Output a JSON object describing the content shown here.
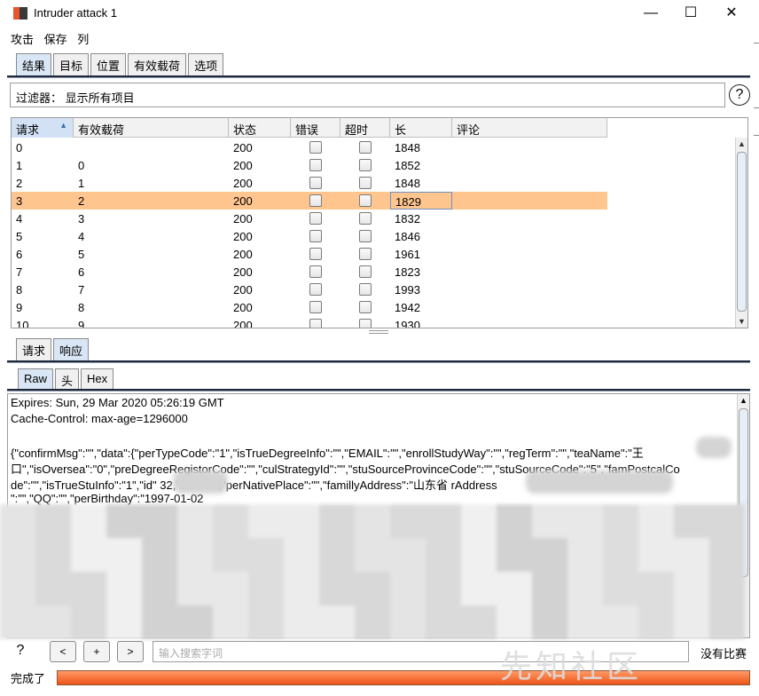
{
  "window": {
    "title": "Intruder attack 1",
    "minimize": "—",
    "maximize": "☐",
    "close": "✕"
  },
  "menu": [
    "攻击",
    "保存",
    "列"
  ],
  "main_tabs": [
    "结果",
    "目标",
    "位置",
    "有效载荷",
    "选项"
  ],
  "filter": {
    "text": "过滤器： 显示所有项目",
    "help": "?"
  },
  "table": {
    "columns": [
      "请求",
      "有效载荷",
      "状态",
      "错误",
      "超时",
      "长",
      "评论"
    ],
    "sort_indicator": "▲",
    "rows": [
      {
        "request": "0",
        "payload": "",
        "status": "200",
        "length": "1848"
      },
      {
        "request": "1",
        "payload": "0",
        "status": "200",
        "length": "1852"
      },
      {
        "request": "2",
        "payload": "1",
        "status": "200",
        "length": "1848"
      },
      {
        "request": "3",
        "payload": "2",
        "status": "200",
        "length": "1829"
      },
      {
        "request": "4",
        "payload": "3",
        "status": "200",
        "length": "1832"
      },
      {
        "request": "5",
        "payload": "4",
        "status": "200",
        "length": "1846"
      },
      {
        "request": "6",
        "payload": "5",
        "status": "200",
        "length": "1961"
      },
      {
        "request": "7",
        "payload": "6",
        "status": "200",
        "length": "1823"
      },
      {
        "request": "8",
        "payload": "7",
        "status": "200",
        "length": "1993"
      },
      {
        "request": "9",
        "payload": "8",
        "status": "200",
        "length": "1942"
      },
      {
        "request": "10",
        "payload": "9",
        "status": "200",
        "length": "1930"
      }
    ],
    "selected_row": 3,
    "selected_color": "#ffc58f"
  },
  "detail_tabs": [
    "请求",
    "响应"
  ],
  "view_tabs": [
    "Raw",
    "头",
    "Hex"
  ],
  "response_lines": [
    "Expires: Sun, 29 Mar 2020 05:26:19 GMT",
    "Cache-Control: max-age=1296000",
    "",
    "{\"confirmMsg\":\"\",\"data\":{\"perTypeCode\":\"1\",\"isTrueDegreeInfo\":\"\",\"EMAIL\":\"\",\"enrollStudyWay\":\"\",\"regTerm\":\"\",\"teaName\":\"王",
    "口\",\"isOversea\":\"0\",\"preDegreeRegistorCode\":\"\",\"culStrategyId\":\"\",\"stuSourceProvinceCode\":\"\",\"stuSourceCode\":\"5\",\"famPostcalCo",
    "de\":\"\",\"isTrueStuInfo\":\"1\",\"id\"             32,\"state\":1,\"perNativePlace\":\"\",\"famillyAddress\":\"山东省                                      rAddress",
    "\":\"\",\"QQ\":\"\",\"perBirthday\":\"1997-01-02"
  ],
  "search": {
    "placeholder": "输入搜索字词",
    "no_match": "没有比赛"
  },
  "status": {
    "text": "完成了",
    "progress": 1.0
  },
  "watermark": "先知社区"
}
